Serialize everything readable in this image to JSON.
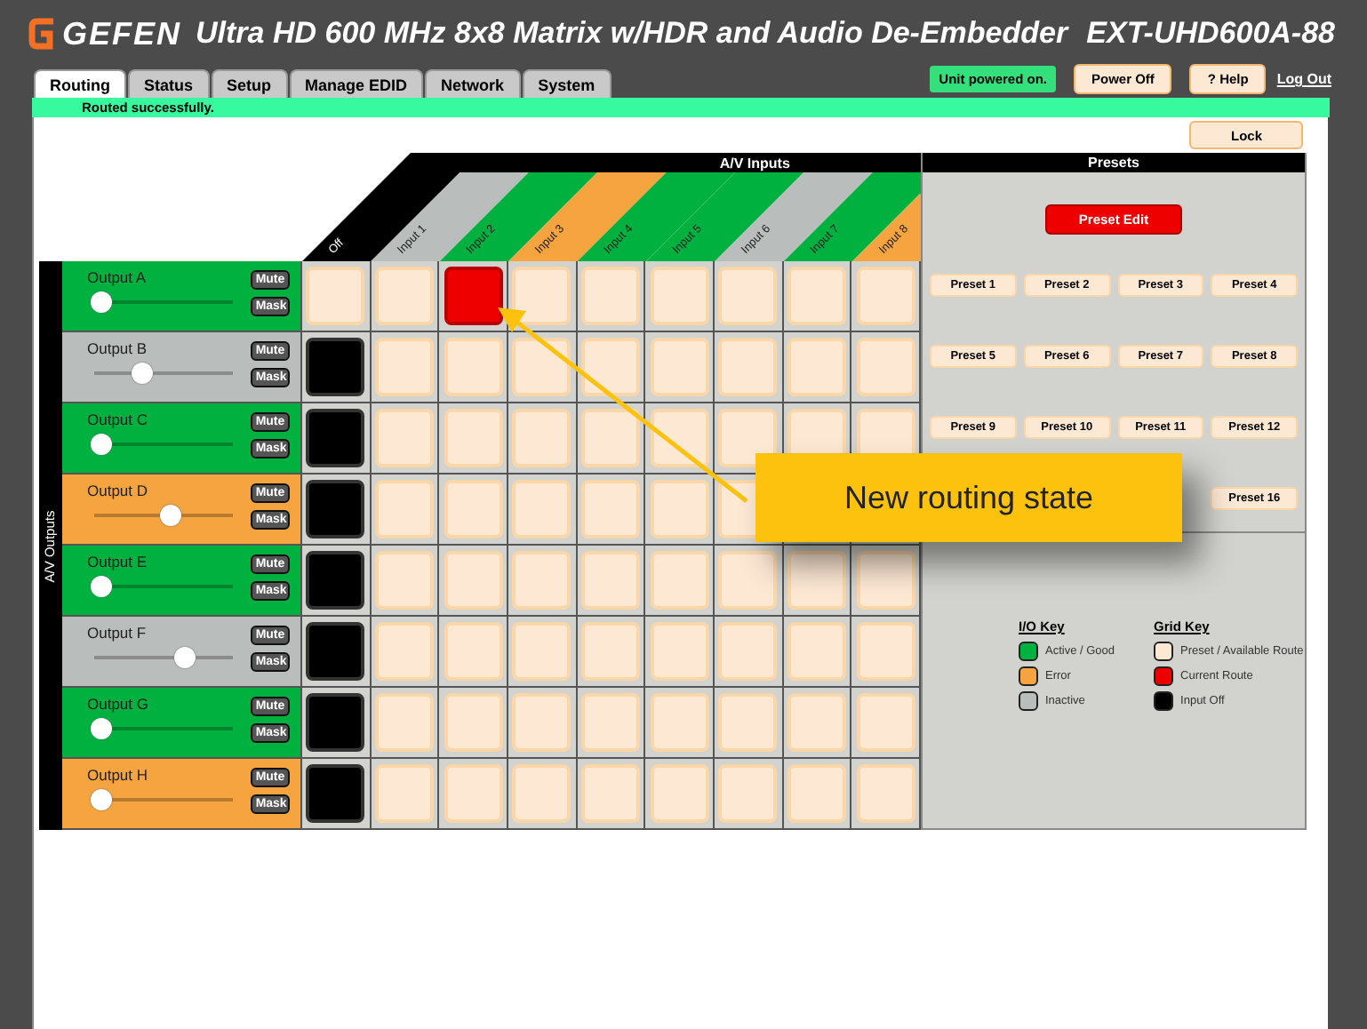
{
  "header": {
    "brand": "GEFEN",
    "title": "Ultra HD 600 MHz 8x8 Matrix w/HDR and Audio De-Embedder",
    "model": "EXT-UHD600A-88"
  },
  "tabs": [
    {
      "label": "Routing",
      "selected": true
    },
    {
      "label": "Status",
      "selected": false
    },
    {
      "label": "Setup",
      "selected": false
    },
    {
      "label": "Manage EDID",
      "selected": false
    },
    {
      "label": "Network",
      "selected": false
    },
    {
      "label": "System",
      "selected": false
    }
  ],
  "power_status": "Unit powered on.",
  "power_button": "Power Off",
  "help_button": "? Help",
  "logout_link": "Log Out",
  "status_message": "Routed successfully.",
  "lock_button": "Lock",
  "inputs_title": "A/V Inputs",
  "inputs": [
    {
      "label": "Off",
      "color": "#000000"
    },
    {
      "label": "Input 1",
      "color": "#b9bdbb"
    },
    {
      "label": "Input 2",
      "color": "#00b140"
    },
    {
      "label": "Input 3",
      "color": "#f6a43f"
    },
    {
      "label": "Input 4",
      "color": "#00b140"
    },
    {
      "label": "Input 5",
      "color": "#00b140"
    },
    {
      "label": "Input 6",
      "color": "#b9bdbb"
    },
    {
      "label": "Input 7",
      "color": "#00b140"
    },
    {
      "label": "Input 8",
      "color": "#f6a43f"
    }
  ],
  "outputs_title": "A/V Outputs",
  "outputs": [
    {
      "name": "Output A",
      "color": "#00b140",
      "level": 0.05,
      "mute": "Mute",
      "mask": "Mask",
      "cells": [
        {
          "selected": false
        },
        {
          "selected": false
        },
        {
          "selected": true
        },
        {
          "selected": false
        },
        {
          "selected": false
        },
        {
          "selected": false
        },
        {
          "selected": false
        },
        {
          "selected": false
        },
        {
          "selected": false
        }
      ]
    },
    {
      "name": "Output B",
      "color": "#b9bdbb",
      "level": 0.35,
      "mute": "Mute",
      "mask": "Mask",
      "cells": [
        {
          "selected": true
        },
        {
          "selected": false
        },
        {
          "selected": false
        },
        {
          "selected": false
        },
        {
          "selected": false
        },
        {
          "selected": false
        },
        {
          "selected": false
        },
        {
          "selected": false
        },
        {
          "selected": false
        }
      ]
    },
    {
      "name": "Output C",
      "color": "#00b140",
      "level": 0.05,
      "mute": "Mute",
      "mask": "Mask",
      "cells": [
        {
          "selected": true
        },
        {
          "selected": false
        },
        {
          "selected": false
        },
        {
          "selected": false
        },
        {
          "selected": false
        },
        {
          "selected": false
        },
        {
          "selected": false
        },
        {
          "selected": false
        },
        {
          "selected": false
        }
      ]
    },
    {
      "name": "Output D",
      "color": "#f6a43f",
      "level": 0.55,
      "mute": "Mute",
      "mask": "Mask",
      "cells": [
        {
          "selected": true
        },
        {
          "selected": false
        },
        {
          "selected": false
        },
        {
          "selected": false
        },
        {
          "selected": false
        },
        {
          "selected": false
        },
        {
          "selected": false
        }
      ]
    },
    {
      "name": "Output E",
      "color": "#00b140",
      "level": 0.05,
      "mute": "Mute",
      "mask": "Mask",
      "cells": [
        {
          "selected": true
        },
        {
          "selected": false
        },
        {
          "selected": false
        },
        {
          "selected": false
        },
        {
          "selected": false
        },
        {
          "selected": false
        },
        {
          "selected": false
        },
        {
          "selected": false
        },
        {
          "selected": false
        }
      ]
    },
    {
      "name": "Output F",
      "color": "#b9bdbb",
      "level": 0.65,
      "mute": "Mute",
      "mask": "Mask",
      "cells": [
        {
          "selected": true
        },
        {
          "selected": false
        },
        {
          "selected": false
        },
        {
          "selected": false
        },
        {
          "selected": false
        },
        {
          "selected": false
        },
        {
          "selected": false
        },
        {
          "selected": false
        },
        {
          "selected": false
        }
      ]
    },
    {
      "name": "Output G",
      "color": "#00b140",
      "level": 0.05,
      "mute": "Mute",
      "mask": "Mask",
      "cells": [
        {
          "selected": true
        },
        {
          "selected": false
        },
        {
          "selected": false
        },
        {
          "selected": false
        },
        {
          "selected": false
        },
        {
          "selected": false
        },
        {
          "selected": false
        },
        {
          "selected": false
        },
        {
          "selected": false
        }
      ]
    },
    {
      "name": "Output H",
      "color": "#f6a43f",
      "level": 0.05,
      "mute": "Mute",
      "mask": "Mask",
      "cells": [
        {
          "selected": true
        },
        {
          "selected": false
        },
        {
          "selected": false
        },
        {
          "selected": false
        },
        {
          "selected": false
        },
        {
          "selected": false
        },
        {
          "selected": false
        },
        {
          "selected": false
        },
        {
          "selected": false
        }
      ]
    }
  ],
  "presets": {
    "title": "Presets",
    "edit_button": "Preset Edit",
    "rows": [
      [
        "Preset 1",
        "Preset 2",
        "Preset 3",
        "Preset 4"
      ],
      [
        "Preset 5",
        "Preset 6",
        "Preset 7",
        "Preset 8"
      ],
      [
        "Preset 9",
        "Preset 10",
        "Preset 11",
        "Preset 12"
      ],
      [
        "",
        "",
        "",
        "Preset 16"
      ]
    ]
  },
  "io_key": {
    "title": "I/O Key",
    "items": [
      {
        "label": "Active / Good",
        "color": "#00b140"
      },
      {
        "label": "Error",
        "color": "#f6a43f"
      },
      {
        "label": "Inactive",
        "color": "#b9bdbb"
      }
    ]
  },
  "grid_key": {
    "title": "Grid Key",
    "items": [
      {
        "label": "Preset / Available Route",
        "color": "#fde8d4"
      },
      {
        "label": "Current Route",
        "color": "#ee0000"
      },
      {
        "label": "Input Off",
        "color": "#000000"
      }
    ]
  },
  "callout": {
    "text": "New routing state"
  }
}
